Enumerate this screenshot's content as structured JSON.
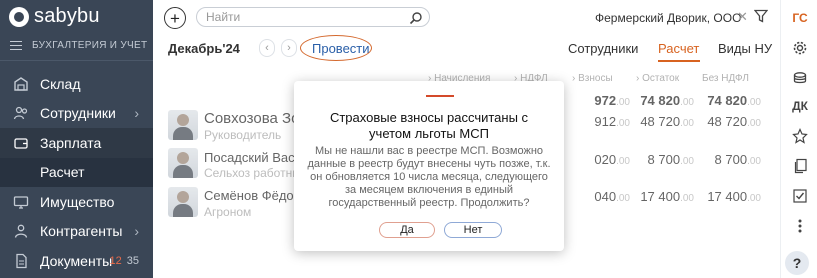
{
  "app": {
    "logo": "sabybu",
    "section": "БУХГАЛТЕРИЯ И УЧЕТ"
  },
  "nav": [
    {
      "label": "Склад",
      "icon": "warehouse-icon"
    },
    {
      "label": "Сотрудники",
      "icon": "employees-icon"
    },
    {
      "label": "Зарплата",
      "icon": "wallet-icon"
    },
    {
      "label": "Расчет"
    },
    {
      "label": "Имущество",
      "icon": "monitor-icon"
    },
    {
      "label": "Контрагенты",
      "icon": "contractors-icon"
    },
    {
      "label": "Документы",
      "icon": "documents-icon",
      "count_a": "12",
      "count_b": "35"
    }
  ],
  "topbar": {
    "add_label": "+",
    "search_placeholder": "Найти",
    "company": "Фермерский Дворик, ООО"
  },
  "rail": {
    "gs": "ГС",
    "dk": "ДК",
    "help": "?"
  },
  "period": {
    "label": "Декабрь'24",
    "prev": "‹",
    "next": "›",
    "post_button": "Провести",
    "tabs": [
      "Сотрудники",
      "Расчет",
      "Виды НУ"
    ]
  },
  "table": {
    "headers": [
      "Начисления",
      "НДФЛ",
      "Взносы",
      "Остаток",
      "Без НДФЛ"
    ],
    "rows": [
      {
        "name": "Совхозова Зоя",
        "role": "Руководитель",
        "c1": "972",
        "c1d": ".00",
        "c2": "74 820",
        "c2d": ".00",
        "c3": "74 820",
        "c3d": ".00"
      },
      {
        "name": "Посадский Вас",
        "role": "Сельхоз работни",
        "c1": "912",
        "c1d": ".00",
        "c2": "48 720",
        "c2d": ".00",
        "c3": "48 720",
        "c3d": ".00"
      },
      {
        "name": "Семёнов Фёдор",
        "role": "Агроном",
        "c1": "020",
        "c1d": ".00",
        "c2": "8 700",
        "c2d": ".00",
        "c3": "8 700",
        "c3d": ".00"
      },
      {
        "name": "",
        "role": "",
        "c1": "040",
        "c1d": ".00",
        "c2": "17 400",
        "c2d": ".00",
        "c3": "17 400",
        "c3d": ".00"
      }
    ]
  },
  "modal": {
    "title": "Страховые взносы рассчитаны с учетом льготы МСП",
    "text": "Мы не нашли вас в реестре МСП. Возможно данные в реестр будут внесены чуть позже, т.к. он обновляется 10 числа месяца, следующего за месяцем включения в единый государственный реестр. Продолжить?",
    "yes": "Да",
    "no": "Нет"
  }
}
